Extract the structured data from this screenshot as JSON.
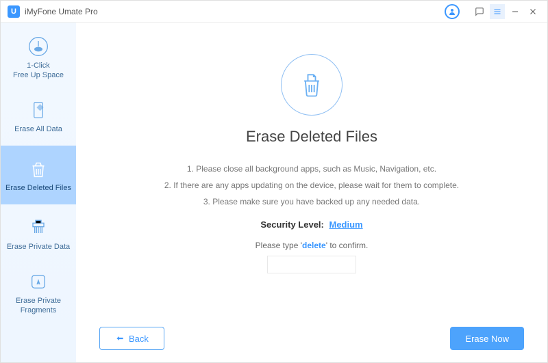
{
  "app": {
    "logo": "U",
    "title": "iMyFone Umate Pro"
  },
  "sidebar": {
    "items": [
      {
        "label": "1-Click\nFree Up Space"
      },
      {
        "label": "Erase All Data"
      },
      {
        "label": "Erase Deleted Files"
      },
      {
        "label": "Erase Private Data"
      },
      {
        "label": "Erase Private\nFragments"
      }
    ]
  },
  "main": {
    "title": "Erase Deleted Files",
    "instruction1": "1. Please close all background apps, such as Music, Navigation, etc.",
    "instruction2": "2. If there are any apps updating on the device, please wait for them to complete.",
    "instruction3": "3. Please make sure you have backed up any needed data.",
    "security_label": "Security Level:",
    "security_value": "Medium",
    "confirm_prefix": "Please type '",
    "confirm_keyword": "delete",
    "confirm_suffix": "' to confirm.",
    "input_value": ""
  },
  "footer": {
    "back": "Back",
    "erase": "Erase Now"
  }
}
